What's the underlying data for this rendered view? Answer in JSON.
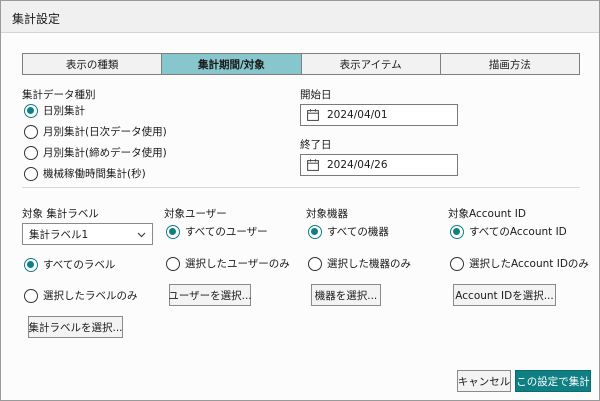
{
  "window": {
    "title": "集計設定"
  },
  "tabs": [
    {
      "label": "表示の種類"
    },
    {
      "label": "集計期間/対象"
    },
    {
      "label": "表示アイテム"
    },
    {
      "label": "描画方法"
    }
  ],
  "aggregation_type": {
    "heading": "集計データ種別",
    "options": [
      {
        "label": "日別集計",
        "checked": true
      },
      {
        "label": "月別集計(日次データ使用)",
        "checked": false
      },
      {
        "label": "月別集計(締めデータ使用)",
        "checked": false
      },
      {
        "label": "機械稼働時間集計(秒)",
        "checked": false
      }
    ]
  },
  "start_date": {
    "label": "開始日",
    "value": "2024/04/01"
  },
  "end_date": {
    "label": "終了日",
    "value": "2024/04/26"
  },
  "target_label": {
    "heading": "対象 集計ラベル",
    "select_value": "集計ラベル1",
    "options": [
      {
        "label": "すべてのラベル",
        "checked": true
      },
      {
        "label": "選択したラベルのみ",
        "checked": false
      }
    ],
    "button": "集計ラベルを選択..."
  },
  "target_user": {
    "heading": "対象ユーザー",
    "options": [
      {
        "label": "すべてのユーザー",
        "checked": true
      },
      {
        "label": "選択したユーザーのみ",
        "checked": false
      }
    ],
    "button": "ユーザーを選択..."
  },
  "target_device": {
    "heading": "対象機器",
    "options": [
      {
        "label": "すべての機器",
        "checked": true
      },
      {
        "label": "選択した機器のみ",
        "checked": false
      }
    ],
    "button": "機器を選択..."
  },
  "target_account": {
    "heading": "対象Account ID",
    "options": [
      {
        "label": "すべてのAccount ID",
        "checked": true
      },
      {
        "label": "選択したAccount IDのみ",
        "checked": false
      }
    ],
    "button": "Account IDを選択..."
  },
  "footer": {
    "cancel": "キャンセル",
    "apply": "この設定で集計"
  },
  "colors": {
    "accent": "#0f7f83",
    "active_tab": "#86c6cc"
  }
}
